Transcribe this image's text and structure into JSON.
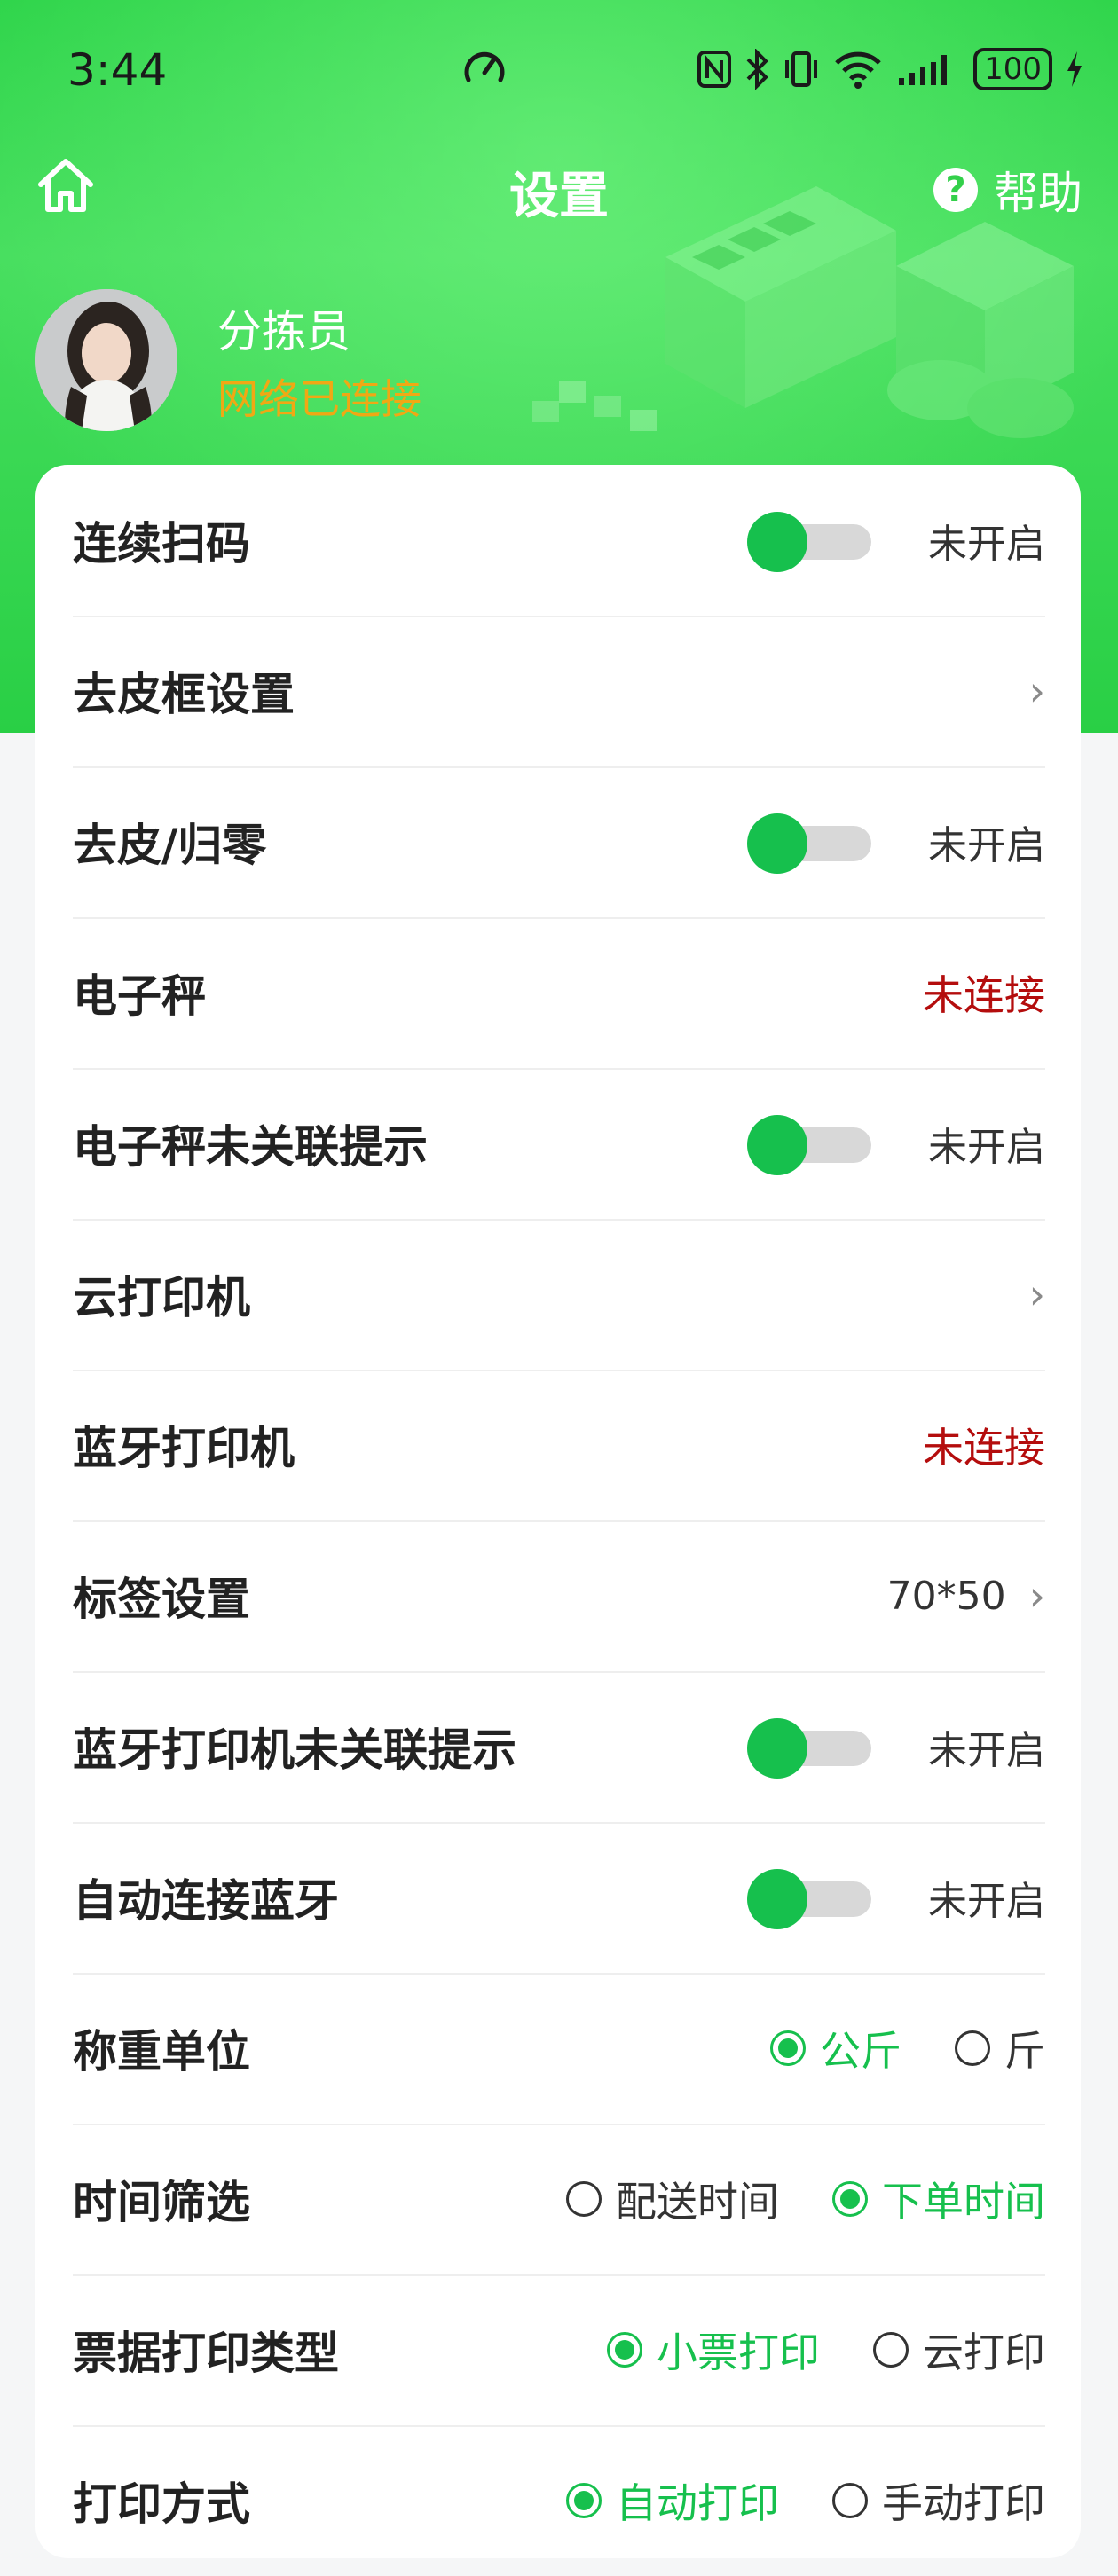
{
  "status_bar": {
    "time": "3:44",
    "battery": "100"
  },
  "header": {
    "title": "设置",
    "help_label": "帮助"
  },
  "profile": {
    "name": "分拣员",
    "network_status": "网络已连接"
  },
  "colors": {
    "brand_green": "#16c04d",
    "header_green": "#2ed44a",
    "error_red": "#b40d0d",
    "warning_orange": "#f0a814"
  },
  "settings": {
    "continuous_scan": {
      "label": "连续扫码",
      "state": "未开启"
    },
    "tare_box": {
      "label": "去皮框设置"
    },
    "tare_zero": {
      "label": "去皮/归零",
      "state": "未开启"
    },
    "scale": {
      "label": "电子秤",
      "status": "未连接"
    },
    "scale_unlinked_tip": {
      "label": "电子秤未关联提示",
      "state": "未开启"
    },
    "cloud_printer": {
      "label": "云打印机"
    },
    "bt_printer": {
      "label": "蓝牙打印机",
      "status": "未连接"
    },
    "label_settings": {
      "label": "标签设置",
      "value": "70*50"
    },
    "bt_printer_unlinked_tip": {
      "label": "蓝牙打印机未关联提示",
      "state": "未开启"
    },
    "auto_connect_bt": {
      "label": "自动连接蓝牙",
      "state": "未开启"
    },
    "weight_unit": {
      "label": "称重单位",
      "options": [
        "公斤",
        "斤"
      ],
      "selected": "公斤"
    },
    "time_filter": {
      "label": "时间筛选",
      "options": [
        "配送时间",
        "下单时间"
      ],
      "selected": "下单时间"
    },
    "ticket_type": {
      "label": "票据打印类型",
      "options": [
        "小票打印",
        "云打印"
      ],
      "selected": "小票打印"
    },
    "print_mode": {
      "label": "打印方式",
      "options": [
        "自动打印",
        "手动打印"
      ],
      "selected": "自动打印"
    }
  }
}
